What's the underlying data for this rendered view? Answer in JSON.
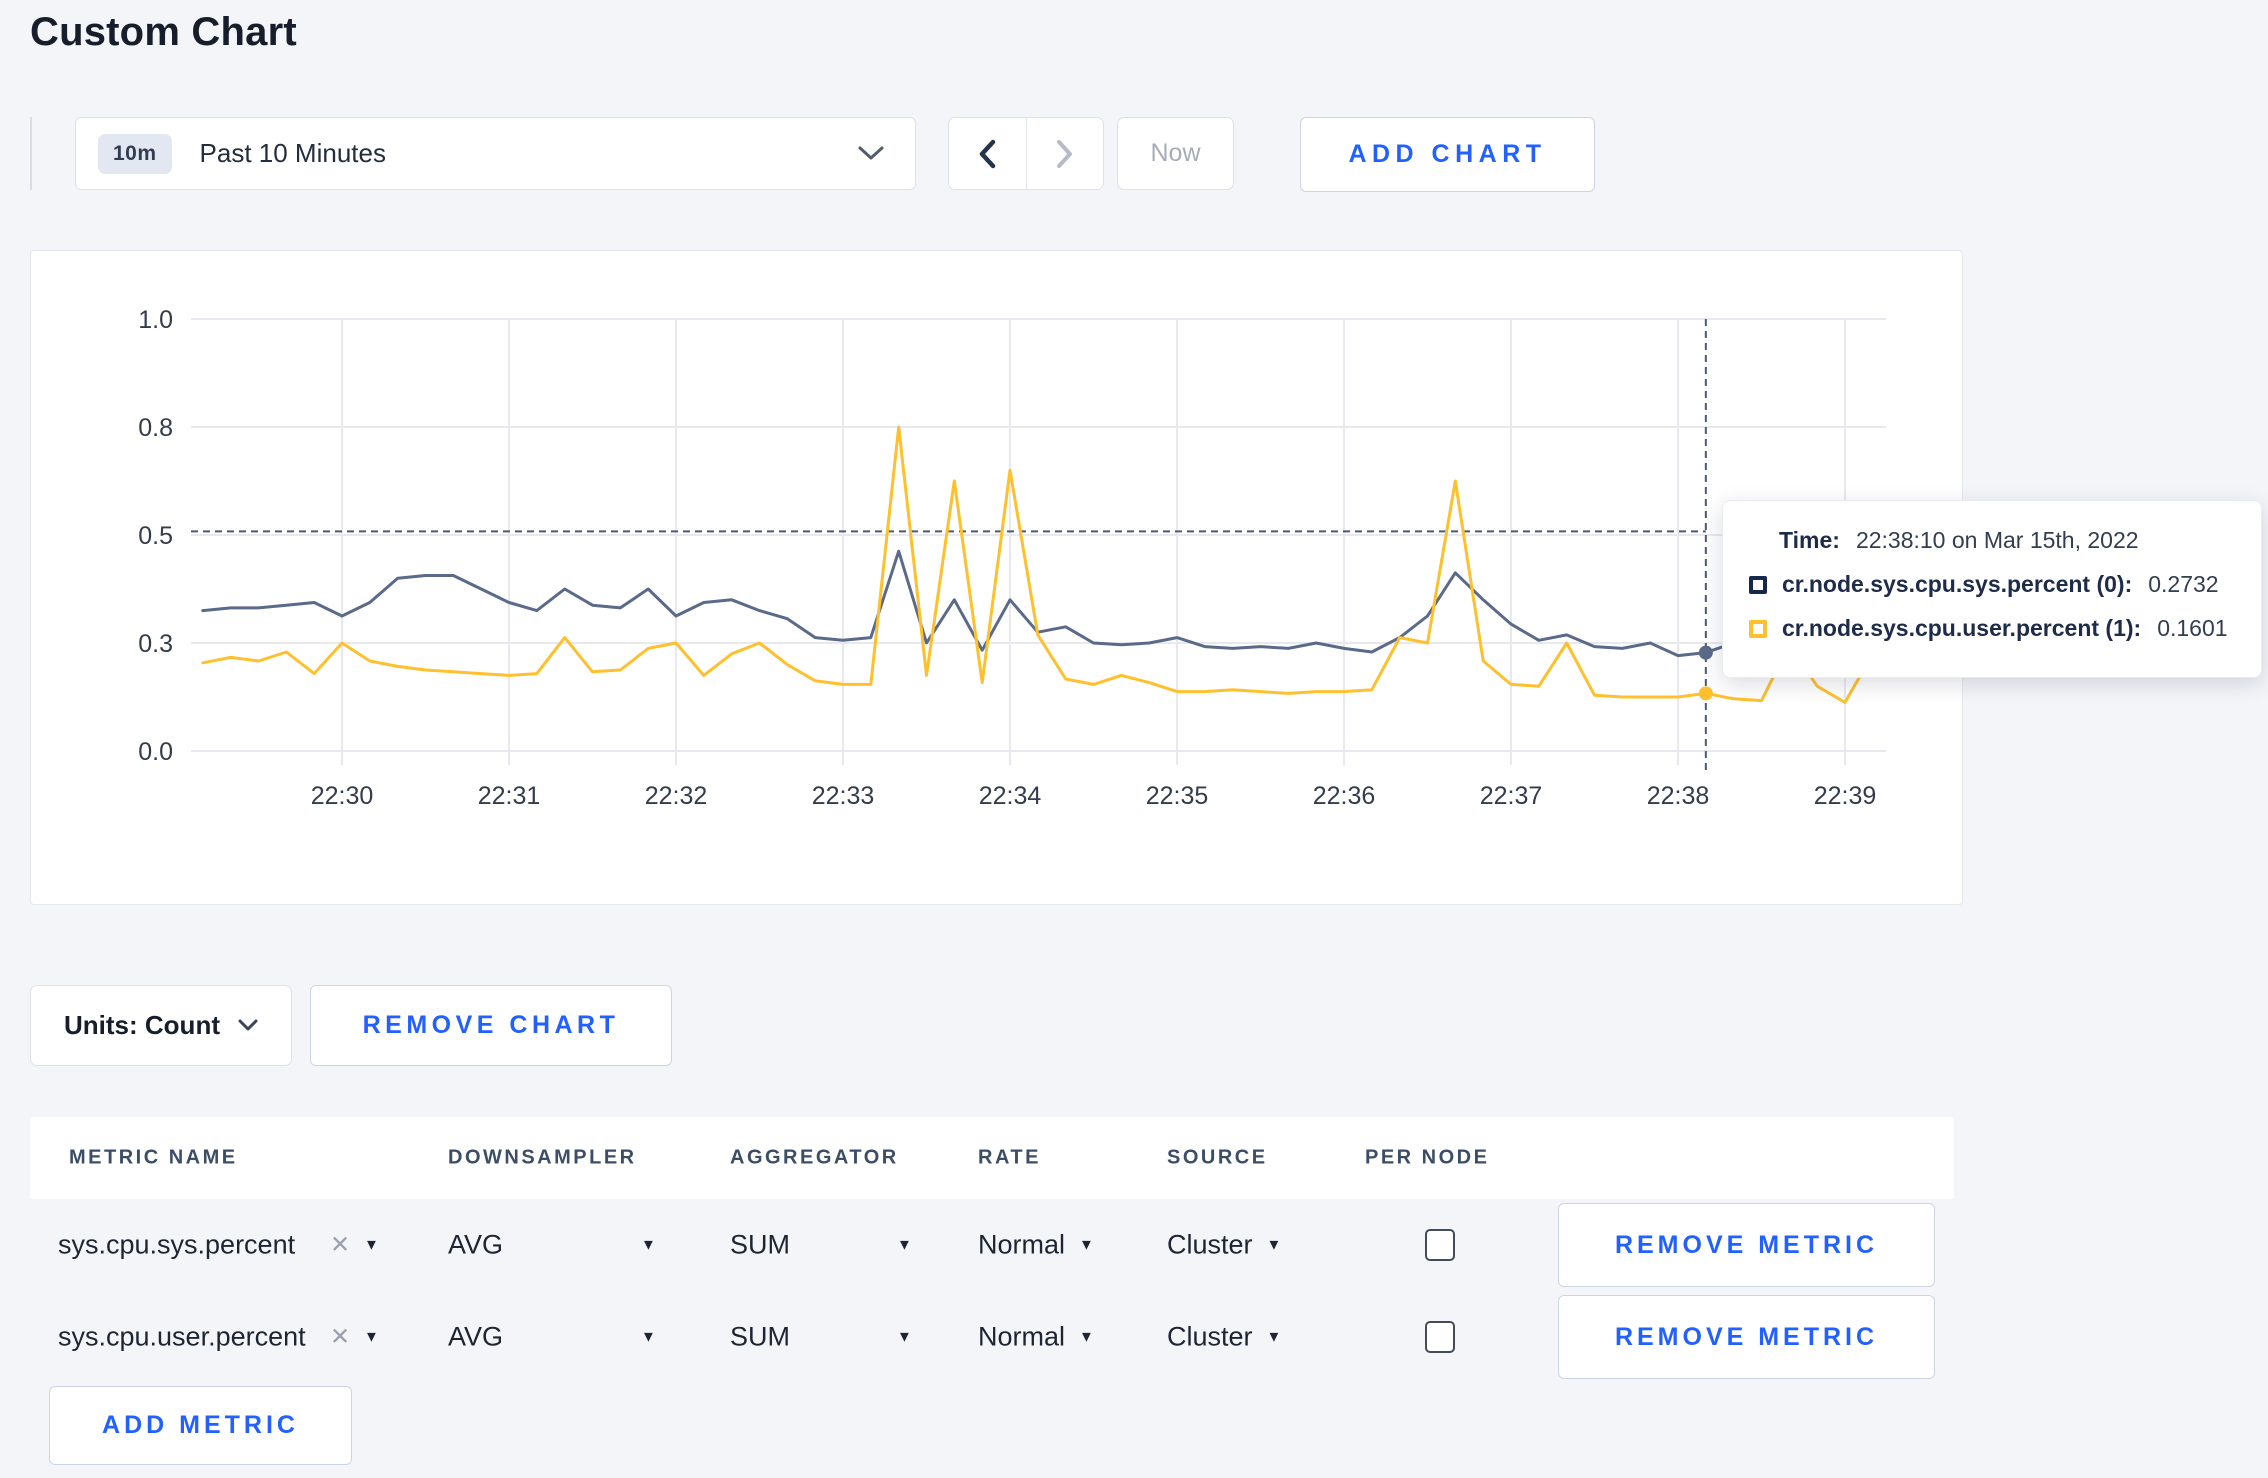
{
  "page": {
    "title": "Custom Chart"
  },
  "colors": {
    "accent_blue": "#2261ff",
    "page_background": "#f4f5f9",
    "grid": "#e8e9ee",
    "crosshair": "#4a5a74",
    "series_sys_line": "#5a6a88",
    "series_user_line": "#ffc02e"
  },
  "toolbar": {
    "time_badge": "10m",
    "time_label": "Past 10 Minutes",
    "now_label": "Now",
    "add_chart_label": "ADD CHART"
  },
  "chart_data": {
    "type": "line",
    "title": "",
    "xlabel": "",
    "ylabel": "",
    "ylim": [
      0,
      1
    ],
    "grid": true,
    "legend_position": "tooltip",
    "x_ticks": [
      "22:30",
      "22:31",
      "22:32",
      "22:33",
      "22:34",
      "22:35",
      "22:36",
      "22:37",
      "22:38",
      "22:39"
    ],
    "y_tick_values": [
      0,
      0.3,
      0.5,
      0.8,
      1.0
    ],
    "y_tick_labels": [
      "0.0",
      "0.3",
      "0.5",
      "0.8",
      "1.0"
    ],
    "start_time": "22:29:10",
    "interval_seconds": 10,
    "hover": {
      "time": "22:38:10",
      "index": 54,
      "guide_value": 0.51
    },
    "series": [
      {
        "name": "cr.node.sys.cpu.sys.percent (0)",
        "color": "#5a6a88",
        "values": [
          0.36,
          0.365,
          0.365,
          0.37,
          0.375,
          0.35,
          0.375,
          0.42,
          0.425,
          0.425,
          0.4,
          0.375,
          0.36,
          0.4,
          0.37,
          0.365,
          0.4,
          0.35,
          0.375,
          0.38,
          0.36,
          0.345,
          0.31,
          0.305,
          0.31,
          0.47,
          0.3,
          0.38,
          0.28,
          0.38,
          0.32,
          0.33,
          0.3,
          0.295,
          0.3,
          0.31,
          0.29,
          0.285,
          0.29,
          0.285,
          0.3,
          0.285,
          0.275,
          0.31,
          0.35,
          0.43,
          0.38,
          0.335,
          0.305,
          0.315,
          0.29,
          0.285,
          0.3,
          0.265,
          0.2732,
          0.3,
          0.315,
          0.3,
          0.295,
          0.3,
          0.305
        ]
      },
      {
        "name": "cr.node.sys.cpu.user.percent (1)",
        "color": "#ffc02e",
        "values": [
          0.245,
          0.26,
          0.25,
          0.275,
          0.215,
          0.3,
          0.25,
          0.235,
          0.225,
          0.22,
          0.215,
          0.21,
          0.215,
          0.31,
          0.22,
          0.225,
          0.285,
          0.3,
          0.21,
          0.27,
          0.3,
          0.24,
          0.195,
          0.185,
          0.185,
          0.8,
          0.21,
          0.65,
          0.19,
          0.68,
          0.315,
          0.2,
          0.185,
          0.21,
          0.19,
          0.165,
          0.165,
          0.17,
          0.165,
          0.16,
          0.165,
          0.165,
          0.17,
          0.31,
          0.3,
          0.65,
          0.25,
          0.185,
          0.18,
          0.3,
          0.155,
          0.15,
          0.15,
          0.15,
          0.1601,
          0.145,
          0.14,
          0.295,
          0.18,
          0.135,
          0.27
        ]
      }
    ]
  },
  "tooltip": {
    "time_label": "Time:",
    "time_value": "22:38:10 on Mar 15th, 2022",
    "series": [
      {
        "label": "cr.node.sys.cpu.sys.percent (0):",
        "value": "0.2732",
        "color": "#16294d"
      },
      {
        "label": "cr.node.sys.cpu.user.percent (1):",
        "value": "0.1601",
        "color": "#ffc02e"
      }
    ]
  },
  "chart_controls": {
    "units_label": "Units: Count",
    "remove_chart_label": "REMOVE CHART"
  },
  "metrics_table": {
    "headers": [
      "METRIC NAME",
      "DOWNSAMPLER",
      "AGGREGATOR",
      "RATE",
      "SOURCE",
      "PER NODE"
    ],
    "rows": [
      {
        "metric_name": "sys.cpu.sys.percent",
        "downsampler": "AVG",
        "aggregator": "SUM",
        "rate": "Normal",
        "source": "Cluster",
        "per_node_checked": false,
        "remove_label": "REMOVE METRIC"
      },
      {
        "metric_name": "sys.cpu.user.percent",
        "downsampler": "AVG",
        "aggregator": "SUM",
        "rate": "Normal",
        "source": "Cluster",
        "per_node_checked": false,
        "remove_label": "REMOVE METRIC"
      }
    ],
    "add_metric_label": "ADD METRIC"
  }
}
